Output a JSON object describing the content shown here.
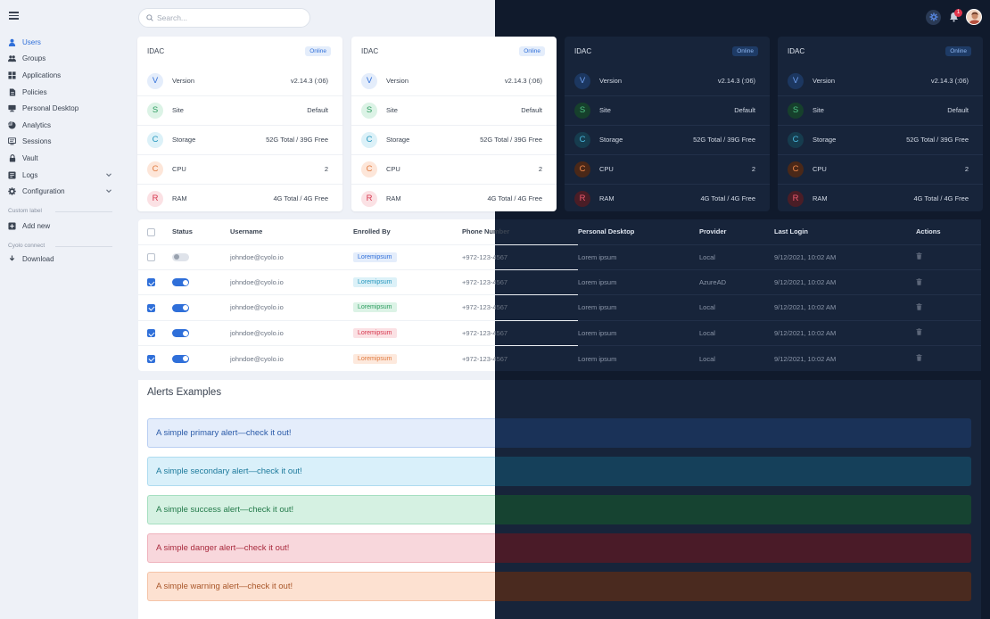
{
  "search": {
    "placeholder": "Search..."
  },
  "notifications": {
    "count": "1"
  },
  "sidebar": {
    "items": [
      {
        "label": "Users",
        "icon": "user-icon"
      },
      {
        "label": "Groups",
        "icon": "group-icon"
      },
      {
        "label": "Applications",
        "icon": "grid-icon"
      },
      {
        "label": "Policies",
        "icon": "document-icon"
      },
      {
        "label": "Personal Desktop",
        "icon": "monitor-icon"
      },
      {
        "label": "Analytics",
        "icon": "pie-chart-icon"
      },
      {
        "label": "Sessions",
        "icon": "sessions-icon"
      },
      {
        "label": "Vault",
        "icon": "lock-icon"
      },
      {
        "label": "Logs",
        "icon": "logs-icon"
      },
      {
        "label": "Configuration",
        "icon": "gear-icon"
      }
    ],
    "custom_label": "Custom label",
    "add_new": "Add new",
    "cyolo_connect": "Cyolo connect",
    "download": "Download"
  },
  "cards": [
    {
      "title": "IDAC",
      "status": "Online",
      "rows": [
        {
          "letter": "V",
          "label": "Version",
          "value": "v2.14.3 (:06)"
        },
        {
          "letter": "S",
          "label": "Site",
          "value": "Default"
        },
        {
          "letter": "C",
          "label": "Storage",
          "value": "52G Total / 39G Free"
        },
        {
          "letter": "C",
          "label": "CPU",
          "value": "2"
        },
        {
          "letter": "R",
          "label": "RAM",
          "value": "4G Total / 4G Free"
        }
      ]
    },
    {
      "title": "IDAC",
      "status": "Online",
      "rows": [
        {
          "letter": "V",
          "label": "Version",
          "value": "v2.14.3 (:06)"
        },
        {
          "letter": "S",
          "label": "Site",
          "value": "Default"
        },
        {
          "letter": "C",
          "label": "Storage",
          "value": "52G Total / 39G Free"
        },
        {
          "letter": "C",
          "label": "CPU",
          "value": "2"
        },
        {
          "letter": "R",
          "label": "RAM",
          "value": "4G Total / 4G Free"
        }
      ]
    },
    {
      "title": "IDAC",
      "status": "Online",
      "rows": [
        {
          "letter": "V",
          "label": "Version",
          "value": "v2.14.3 (:06)"
        },
        {
          "letter": "S",
          "label": "Site",
          "value": "Default"
        },
        {
          "letter": "C",
          "label": "Storage",
          "value": "52G Total / 39G Free"
        },
        {
          "letter": "C",
          "label": "CPU",
          "value": "2"
        },
        {
          "letter": "R",
          "label": "RAM",
          "value": "4G Total / 4G Free"
        }
      ]
    },
    {
      "title": "IDAC",
      "status": "Online",
      "rows": [
        {
          "letter": "V",
          "label": "Version",
          "value": "v2.14.3 (:06)"
        },
        {
          "letter": "S",
          "label": "Site",
          "value": "Default"
        },
        {
          "letter": "C",
          "label": "Storage",
          "value": "52G Total / 39G Free"
        },
        {
          "letter": "C",
          "label": "CPU",
          "value": "2"
        },
        {
          "letter": "R",
          "label": "RAM",
          "value": "4G Total / 4G Free"
        }
      ]
    }
  ],
  "table": {
    "headers": [
      "Status",
      "Username",
      "Enrolled By",
      "Phone Number",
      "Personal Desktop",
      "Provider",
      "Last Login",
      "Actions"
    ],
    "rows": [
      {
        "checked": false,
        "enabled": false,
        "username": "johndoe@cyolo.io",
        "enrolled": "Loremipsum",
        "phone": "+972-123-4567",
        "desktop": "Lorem ipsum",
        "provider": "Local",
        "last_login": "9/12/2021, 10:02 AM"
      },
      {
        "checked": true,
        "enabled": true,
        "username": "johndoe@cyolo.io",
        "enrolled": "Loremipsum",
        "phone": "+972-123-4567",
        "desktop": "Lorem ipsum",
        "provider": "AzureAD",
        "last_login": "9/12/2021, 10:02 AM"
      },
      {
        "checked": true,
        "enabled": true,
        "username": "johndoe@cyolo.io",
        "enrolled": "Loremipsum",
        "phone": "+972-123-4567",
        "desktop": "Lorem ipsum",
        "provider": "Local",
        "last_login": "9/12/2021, 10:02 AM"
      },
      {
        "checked": true,
        "enabled": true,
        "username": "johndoe@cyolo.io",
        "enrolled": "Loremipsum",
        "phone": "+972-123-4567",
        "desktop": "Lorem ipsum",
        "provider": "Local",
        "last_login": "9/12/2021, 10:02 AM"
      },
      {
        "checked": true,
        "enabled": true,
        "username": "johndoe@cyolo.io",
        "enrolled": "Loremipsum",
        "phone": "+972-123-4567",
        "desktop": "Lorem ipsum",
        "provider": "Local",
        "last_login": "9/12/2021, 10:02 AM"
      }
    ]
  },
  "alerts": {
    "title": "Alerts Examples",
    "items": [
      {
        "type": "primary",
        "text": "A simple primary alert—check it out!"
      },
      {
        "type": "secondary",
        "text": "A simple secondary alert—check it out!"
      },
      {
        "type": "success",
        "text": "A simple success alert—check it out!"
      },
      {
        "type": "danger",
        "text": "A simple danger alert—check it out!"
      },
      {
        "type": "warning",
        "text": "A simple warning alert—check it out!"
      }
    ]
  },
  "colors": {
    "accent": "#2f6fd9",
    "light_bg": "#eef1f7",
    "dark_bg": "#101a2c",
    "dark_panel": "#17243a"
  }
}
